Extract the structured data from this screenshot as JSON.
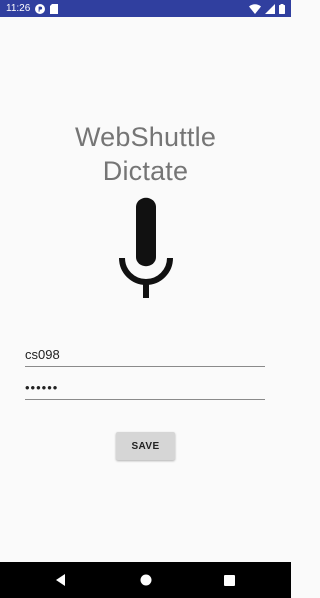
{
  "status_bar": {
    "time": "11:26",
    "icons": [
      "notification-p-icon",
      "sd-card-icon",
      "wifi-icon",
      "signal-icon",
      "battery-icon"
    ]
  },
  "app": {
    "title_line1": "WebShuttle",
    "title_line2": "Dictate",
    "mic_icon": "microphone-icon",
    "username": "cs098",
    "password": "••••••",
    "save_label": "SAVE"
  },
  "nav_bar": {
    "icons": [
      "back-icon",
      "home-icon",
      "recents-icon"
    ]
  },
  "colors": {
    "status_bar": "#303f9f",
    "background": "#fafafa",
    "title": "#757575",
    "button": "#d6d6d6",
    "nav_bar": "#000000"
  }
}
